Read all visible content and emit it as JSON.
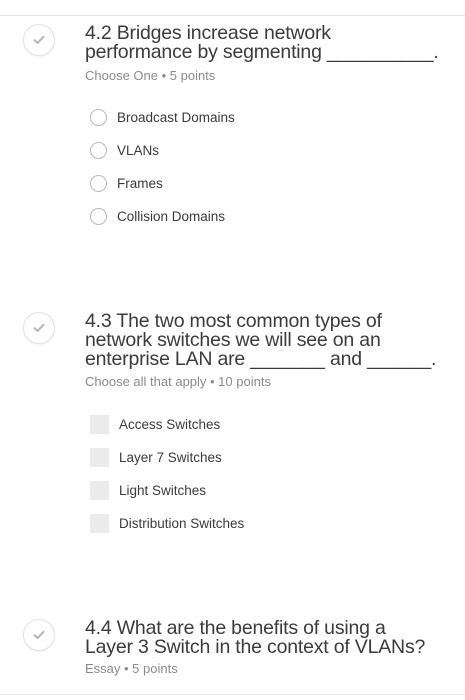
{
  "questions": [
    {
      "number": "4.2",
      "text": "4.2 Bridges increase network performance by segmenting __________.",
      "line1": "4.2 Bridges increase network",
      "line2": "performance by segmenting __________.",
      "meta": "Choose One • 5 points",
      "type": "radio",
      "options": [
        "Broadcast Domains",
        "VLANs",
        "Frames",
        "Collision Domains"
      ]
    },
    {
      "number": "4.3",
      "line1": "4.3 The two most common types of",
      "line2": "network switches we will see on an",
      "line3": "enterprise LAN are _______ and ______.",
      "meta": "Choose all that apply • 10 points",
      "type": "checkbox",
      "options": [
        "Access Switches",
        "Layer 7 Switches",
        "Light Switches",
        "Distribution Switches"
      ]
    },
    {
      "number": "4.4",
      "line1": "4.4 What are the benefits of using a",
      "line2": "Layer 3 Switch in the context of VLANs?",
      "meta": "Essay • 5 points",
      "type": "essay"
    }
  ],
  "colors": {
    "check": "#b5b5b5",
    "radio_border": "#b9b9b9",
    "checkbox_fill": "#ebebeb",
    "meta_text": "#8a8a8a"
  },
  "icons": {
    "status": "check-icon"
  }
}
